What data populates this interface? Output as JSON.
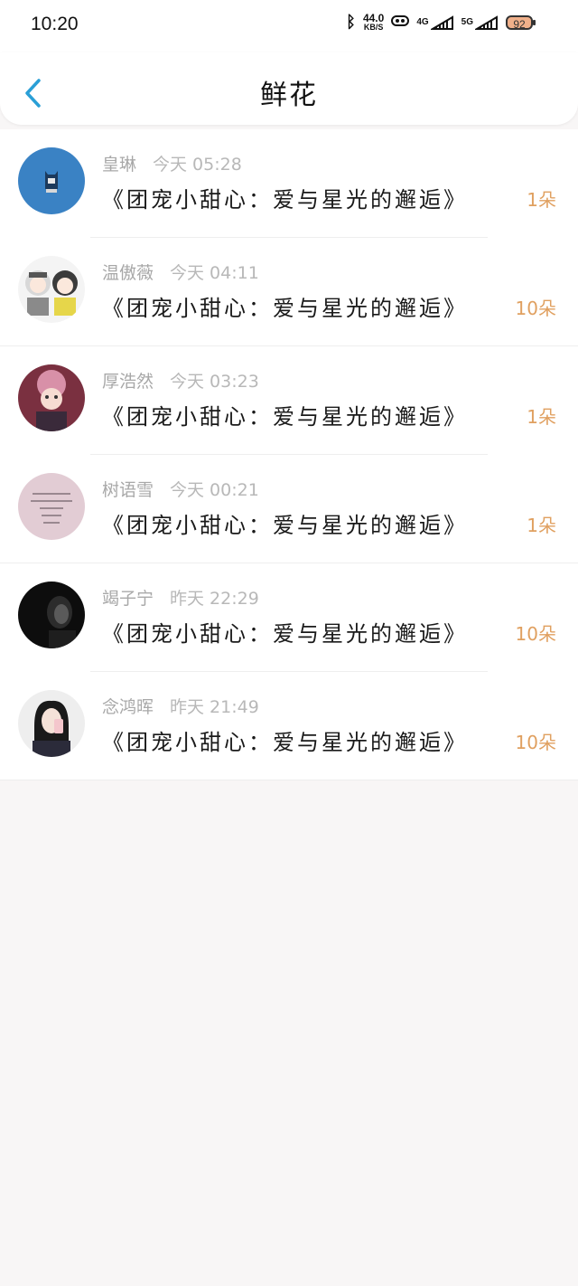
{
  "status_bar": {
    "time": "10:20",
    "net_speed": "44.0",
    "net_unit": "KB/S",
    "signal_1": "4G",
    "signal_2": "5G",
    "battery": "92"
  },
  "header": {
    "title": "鲜花",
    "back_icon": "chevron-left-icon"
  },
  "colors": {
    "accent": "#2a9fd6",
    "count": "#e0a060"
  },
  "list": [
    {
      "name": "皇琳",
      "time": "今天 05:28",
      "gift": "《团宠小甜心：爱与星光的邂逅》",
      "count": "1朵"
    },
    {
      "name": "温傲薇",
      "time": "今天 04:11",
      "gift": "《团宠小甜心：爱与星光的邂逅》",
      "count": "10朵"
    },
    {
      "name": "厚浩然",
      "time": "今天 03:23",
      "gift": "《团宠小甜心：爱与星光的邂逅》",
      "count": "1朵"
    },
    {
      "name": "树语雪",
      "time": "今天 00:21",
      "gift": "《团宠小甜心：爱与星光的邂逅》",
      "count": "1朵"
    },
    {
      "name": "竭子宁",
      "time": "昨天 22:29",
      "gift": "《团宠小甜心：爱与星光的邂逅》",
      "count": "10朵"
    },
    {
      "name": "念鸿晖",
      "time": "昨天 21:49",
      "gift": "《团宠小甜心：爱与星光的邂逅》",
      "count": "10朵"
    }
  ]
}
